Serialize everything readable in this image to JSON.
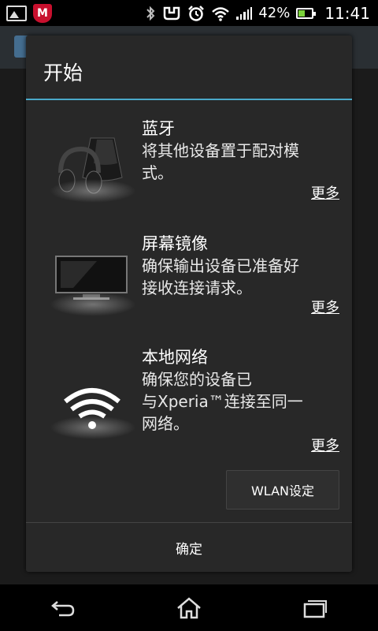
{
  "status_bar": {
    "left_icons": [
      "picture-icon",
      "mcafee-icon"
    ],
    "right_icons": [
      "bluetooth-icon",
      "nfc-icon",
      "alarm-icon",
      "wifi-icon",
      "signal-icon",
      "battery-icon"
    ],
    "battery_percent": "42%",
    "time": "11:41",
    "colors": {
      "battery_fill": "#7ad23a",
      "mcafee": "#c8102e"
    }
  },
  "dialog": {
    "title": "开始",
    "accent_color": "#4aa9c9",
    "sections": [
      {
        "title": "蓝牙",
        "desc_lines": [
          "将其他设备置于配对模",
          "式。"
        ],
        "more": "更多",
        "icon": "headphones-speaker-icon"
      },
      {
        "title": "屏幕镜像",
        "desc_lines": [
          "确保输出设备已准备好",
          "接收连接请求。"
        ],
        "more": "更多",
        "icon": "tv-icon"
      },
      {
        "title": "本地网络",
        "desc_lines": [
          "确保您的设备已",
          "与Xperia™连接至同一",
          "网络。"
        ],
        "more": "更多",
        "icon": "wifi-icon"
      }
    ],
    "wlan_button": "WLAN设定",
    "ok_button": "确定"
  },
  "nav": {
    "buttons": [
      "back-icon",
      "home-icon",
      "recent-apps-icon"
    ]
  }
}
